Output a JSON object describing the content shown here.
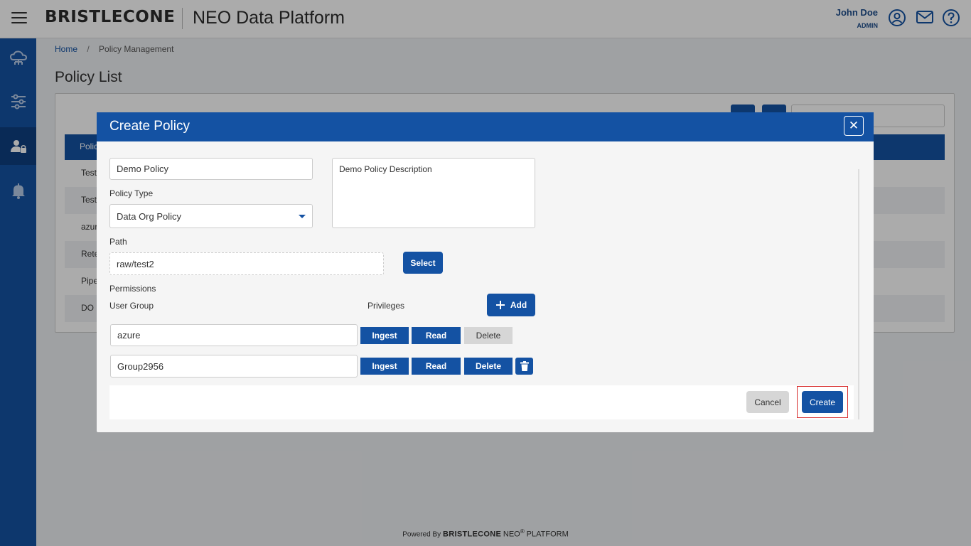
{
  "header": {
    "logo": "BRISTLECONE",
    "app_title": "NEO Data Platform",
    "user_name": "John Doe",
    "user_role": "ADMIN",
    "icons": [
      "menu-icon",
      "user-circle-icon",
      "mail-icon",
      "help-icon"
    ]
  },
  "sidebar": {
    "items": [
      {
        "name": "cloud-data-icon"
      },
      {
        "name": "pipeline-icon"
      },
      {
        "name": "policy-management-icon",
        "active": true
      },
      {
        "name": "notifications-icon"
      }
    ]
  },
  "breadcrumb": {
    "home": "Home",
    "separator": "/",
    "current": "Policy Management"
  },
  "page": {
    "title": "Policy List",
    "table_header": "Polic",
    "rows": [
      "Test",
      "Test",
      "azur",
      "Rete",
      "Pipe",
      "DO F"
    ]
  },
  "modal": {
    "title": "Create Policy",
    "close_symbol": "✕",
    "policy_name": "Demo Policy",
    "description": "Demo Policy Description",
    "policy_type_label": "Policy Type",
    "policy_type_value": "Data Org Policy",
    "path_label": "Path",
    "path_value": "raw/test2",
    "select_button": "Select",
    "permissions_label": "Permissions",
    "user_group_label": "User Group",
    "privileges_label": "Privileges",
    "add_button": "Add",
    "permissions": [
      {
        "group": "azure",
        "privileges": [
          {
            "label": "Ingest",
            "selected": true
          },
          {
            "label": "Read",
            "selected": true
          },
          {
            "label": "Delete",
            "selected": false
          }
        ],
        "deletable": false
      },
      {
        "group": "Group2956",
        "privileges": [
          {
            "label": "Ingest",
            "selected": true
          },
          {
            "label": "Read",
            "selected": true
          },
          {
            "label": "Delete",
            "selected": true
          }
        ],
        "deletable": true
      }
    ],
    "cancel_button": "Cancel",
    "create_button": "Create"
  },
  "footer": {
    "powered_by": "Powered By",
    "brand": "BRISTLECONE",
    "product": "NEO",
    "registered": "®",
    "platform": "PLATFORM"
  },
  "colors": {
    "primary": "#1452a3",
    "sidebar_active": "#0e3f80",
    "highlight_outline": "#d82c2c",
    "inactive_privilege": "#d6d6d6"
  }
}
